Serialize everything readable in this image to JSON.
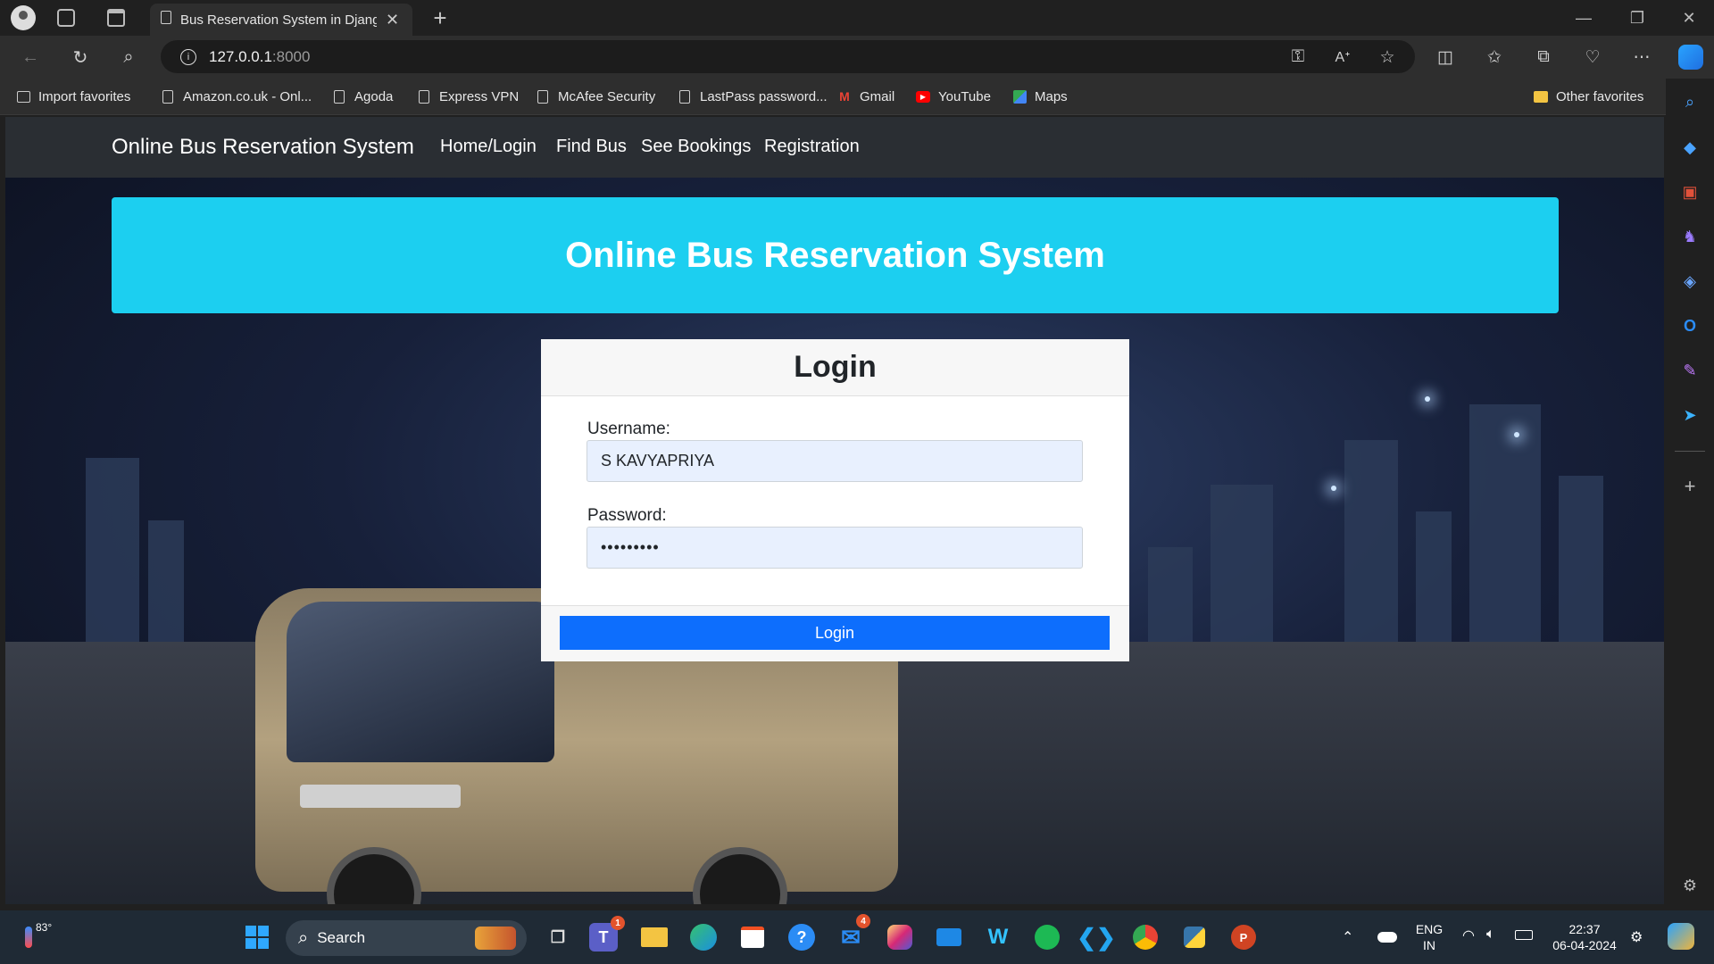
{
  "browser": {
    "tab_title": "Bus Reservation System in Djang",
    "url_host": "127.0.0.1",
    "url_port": ":8000",
    "favorites": [
      {
        "label": "Import favorites",
        "icon": "import-icon"
      },
      {
        "label": "Amazon.co.uk - Onl...",
        "icon": "page-icon"
      },
      {
        "label": "Agoda",
        "icon": "page-icon"
      },
      {
        "label": "Express VPN",
        "icon": "page-icon"
      },
      {
        "label": "McAfee Security",
        "icon": "page-icon"
      },
      {
        "label": "LastPass password...",
        "icon": "page-icon"
      },
      {
        "label": "Gmail",
        "icon": "gmail-icon"
      },
      {
        "label": "YouTube",
        "icon": "youtube-icon"
      },
      {
        "label": "Maps",
        "icon": "maps-icon"
      }
    ],
    "other_favorites": "Other favorites"
  },
  "site": {
    "brand": "Online Bus Reservation System",
    "nav": [
      "Home/Login",
      "Find Bus",
      "See Bookings",
      "Registration"
    ],
    "banner_title": "Online Bus Reservation System"
  },
  "login": {
    "title": "Login",
    "username_label": "Username:",
    "username_value": "S KAVYAPRIYA",
    "password_label": "Password:",
    "password_value": "•••••••••",
    "button": "Login"
  },
  "taskbar": {
    "weather_temp": "83°",
    "search_placeholder": "Search",
    "lang_line1": "ENG",
    "lang_line2": "IN",
    "time": "22:37",
    "date": "06-04-2024",
    "teams_badge": "1",
    "mail_badge": "4"
  },
  "colors": {
    "banner": "#1ccff0",
    "login_button": "#0d6efd",
    "navbar": "#2a2e33"
  }
}
